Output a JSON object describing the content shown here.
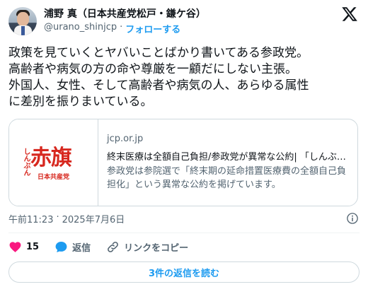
{
  "author": {
    "name": "浦野 真（日本共産党松戸・鎌ケ谷）",
    "handle": "@urano_shinjcp",
    "separator": "·",
    "follow_label": "フォローする"
  },
  "tweet": {
    "lines": [
      "政策を見ていくとヤバいことばかり書いてある参政党。",
      "高齢者や病気の方の命や尊厳を一顧だにしない主張。",
      "外国人、女性、そして高齢者や病気の人、あらゆる属性",
      "に差別を振りまいている。"
    ]
  },
  "link_card": {
    "logo_small": "しんぶん",
    "logo_big": "赤旗",
    "logo_sub": "日本共産党",
    "domain": "jcp.or.jp",
    "title": "終末医療は全額自己負担/参政党が異常な公約| 「しんぶん赤旗」",
    "description": "参政党は参院選で「終末期の延命措置医療費の全額自己負担化」という異常な公約を掲げています。"
  },
  "meta": {
    "time": "午前11:23",
    "separator": "·",
    "date": "2025年7月6日"
  },
  "actions": {
    "like_count": "15",
    "reply_label": "返信",
    "copy_link_label": "リンクをコピー"
  },
  "replies_button": "3件の返信を読む",
  "colors": {
    "accent": "#1d9bf0",
    "like": "#f91880",
    "brand_red": "#d7281f"
  },
  "icons": [
    "x-logo-icon",
    "info-icon",
    "heart-icon",
    "reply-bubble-icon",
    "link-icon"
  ]
}
